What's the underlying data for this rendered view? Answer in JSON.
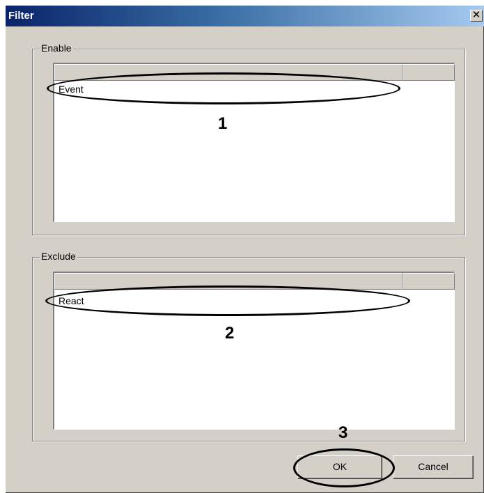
{
  "window": {
    "title": "Filter",
    "close_glyph": "✕"
  },
  "enable": {
    "label": "Enable",
    "rows": [
      "Event"
    ],
    "callout": "1"
  },
  "exclude": {
    "label": "Exclude",
    "rows": [
      "React"
    ],
    "callout": "2"
  },
  "buttons": {
    "ok": "OK",
    "cancel": "Cancel",
    "callout": "3"
  },
  "colors": {
    "dialog_bg": "#d4d0c8",
    "title_start": "#0a246a",
    "title_end": "#a6caf0"
  }
}
